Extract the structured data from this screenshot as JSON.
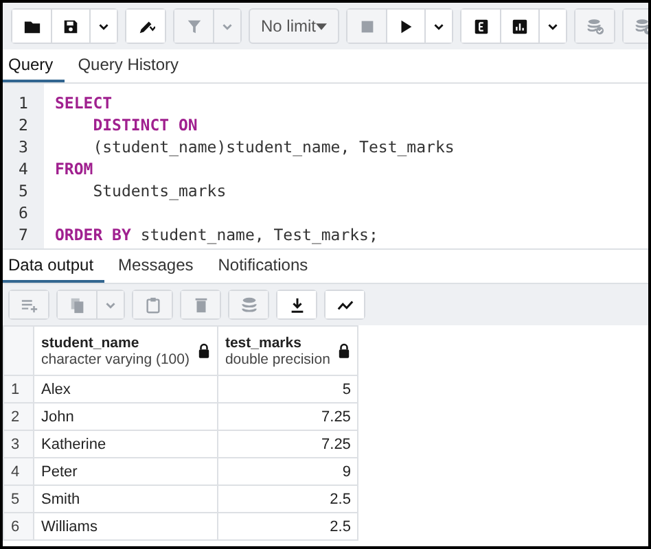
{
  "toolbar": {
    "groups": [
      {
        "buttons": [
          {
            "disabled": false
          },
          {
            "disabled": false
          },
          {
            "disabled": false
          }
        ]
      },
      {
        "buttons": [
          {
            "disabled": false
          }
        ]
      },
      {
        "buttons": [
          {
            "disabled": true
          },
          {
            "disabled": true
          }
        ]
      },
      {
        "limit": {
          "value": "No limit",
          "disabled": true
        }
      },
      {
        "buttons": [
          {
            "disabled": true
          },
          {
            "disabled": false
          },
          {
            "disabled": false
          }
        ]
      },
      {
        "buttons": [
          {
            "disabled": false
          },
          {
            "disabled": false
          },
          {
            "disabled": false
          }
        ]
      },
      {
        "buttons": [
          {
            "disabled": true
          }
        ]
      },
      {
        "buttons": [
          {
            "disabled": true
          }
        ]
      }
    ]
  },
  "editor_tabs": [
    {
      "label": "Query",
      "selected": true
    },
    {
      "label": "Query History",
      "selected": false
    }
  ],
  "code_lines": [
    {
      "number": "1",
      "tokens": [
        {
          "text": "SELECT",
          "kind": "keyword"
        }
      ]
    },
    {
      "number": "2",
      "tokens": [
        {
          "text": "    DISTINCT ON",
          "kind": "keyword"
        }
      ]
    },
    {
      "number": "3",
      "tokens": [
        {
          "text": "    (student_name)student_name, Test_marks",
          "kind": "plain"
        }
      ]
    },
    {
      "number": "4",
      "tokens": [
        {
          "text": "FROM",
          "kind": "keyword"
        }
      ]
    },
    {
      "number": "5",
      "tokens": [
        {
          "text": "    Students_marks",
          "kind": "plain"
        }
      ]
    },
    {
      "number": "6"
    },
    {
      "number": "7",
      "tokens": [
        {
          "text": "ORDER BY",
          "kind": "keyword"
        },
        {
          "text": " student_name, Test_marks;",
          "kind": "plain"
        }
      ]
    }
  ],
  "output_tabs": [
    {
      "label": "Data output",
      "selected": true
    },
    {
      "label": "Messages",
      "selected": false
    },
    {
      "label": "Notifications",
      "selected": false
    }
  ],
  "output_toolbar": {
    "buttons": [
      {
        "disabled": true
      },
      {
        "disabled": true
      },
      {
        "disabled": true
      },
      {
        "disabled": true
      },
      {
        "disabled": true
      },
      {
        "disabled": true
      },
      {
        "disabled": false
      },
      {
        "disabled": false
      }
    ]
  },
  "table": {
    "columns": [
      {
        "name": "student_name",
        "type": "character varying (100)"
      },
      {
        "name": "test_marks",
        "type": "double precision"
      }
    ],
    "rows": [
      {
        "number": "1",
        "cells": [
          "Alex",
          "5"
        ]
      },
      {
        "number": "2",
        "cells": [
          "John",
          "7.25"
        ]
      },
      {
        "number": "3",
        "cells": [
          "Katherine",
          "7.25"
        ]
      },
      {
        "number": "4",
        "cells": [
          "Peter",
          "9"
        ]
      },
      {
        "number": "5",
        "cells": [
          "Smith",
          "2.5"
        ]
      },
      {
        "number": "6",
        "cells": [
          "Williams",
          "2.5"
        ]
      }
    ]
  }
}
